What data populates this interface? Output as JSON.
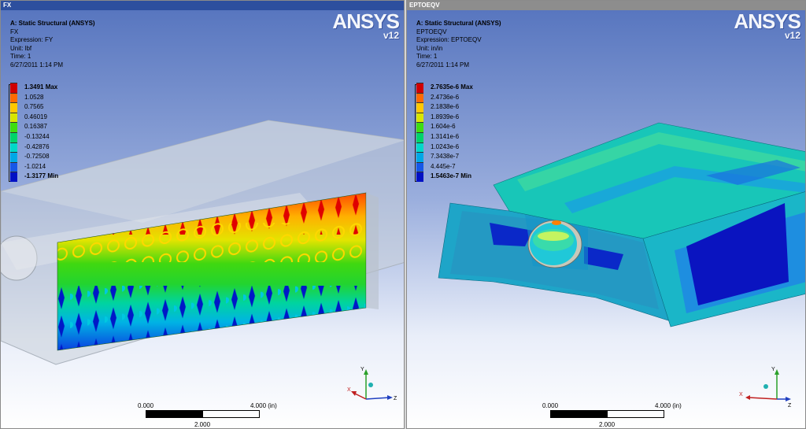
{
  "left_panel": {
    "window_title": "FX",
    "analysis": "A: Static Structural (ANSYS)",
    "result_name": "FX",
    "expression": "Expression: FY",
    "unit": "Unit: lbf",
    "time": "Time: 1",
    "date": "6/27/2011 1:14 PM",
    "legend": [
      {
        "label": "1.3491 Max",
        "color": "#d00000"
      },
      {
        "label": "1.0528",
        "color": "#ff6a00"
      },
      {
        "label": "0.7565",
        "color": "#ffc800"
      },
      {
        "label": "0.46019",
        "color": "#d8e600"
      },
      {
        "label": "0.16387",
        "color": "#3fdd10"
      },
      {
        "label": "-0.13244",
        "color": "#00d46a"
      },
      {
        "label": "-0.42876",
        "color": "#00d8c8"
      },
      {
        "label": "-0.72508",
        "color": "#00a8e6"
      },
      {
        "label": "-1.0214",
        "color": "#1658e8"
      },
      {
        "label": "-1.3177 Min",
        "color": "#0010c4"
      }
    ],
    "scale_start": "0.000",
    "scale_end": "4.000 (in)",
    "scale_mid": "2.000"
  },
  "right_panel": {
    "window_title": "EPTOEQV",
    "analysis": "A: Static Structural (ANSYS)",
    "result_name": "EPTOEQV",
    "expression": "Expression: EPTOEQV",
    "unit": "Unit: in/in",
    "time": "Time: 1",
    "date": "6/27/2011 1:14 PM",
    "legend": [
      {
        "label": "2.7635e-6 Max",
        "color": "#d00000"
      },
      {
        "label": "2.4736e-6",
        "color": "#ff6a00"
      },
      {
        "label": "2.1838e-6",
        "color": "#ffc800"
      },
      {
        "label": "1.8939e-6",
        "color": "#d8e600"
      },
      {
        "label": "1.604e-6",
        "color": "#3fdd10"
      },
      {
        "label": "1.3141e-6",
        "color": "#00d46a"
      },
      {
        "label": "1.0243e-6",
        "color": "#00d8c8"
      },
      {
        "label": "7.3438e-7",
        "color": "#00a8e6"
      },
      {
        "label": "4.445e-7",
        "color": "#1658e8"
      },
      {
        "label": "1.5463e-7 Min",
        "color": "#0010c4"
      }
    ],
    "scale_start": "0.000",
    "scale_end": "4.000 (in)",
    "scale_mid": "2.000"
  },
  "logo": {
    "brand": "ANSYS",
    "version": "v12"
  },
  "axes": {
    "x": "X",
    "y": "Y",
    "z": "Z"
  }
}
